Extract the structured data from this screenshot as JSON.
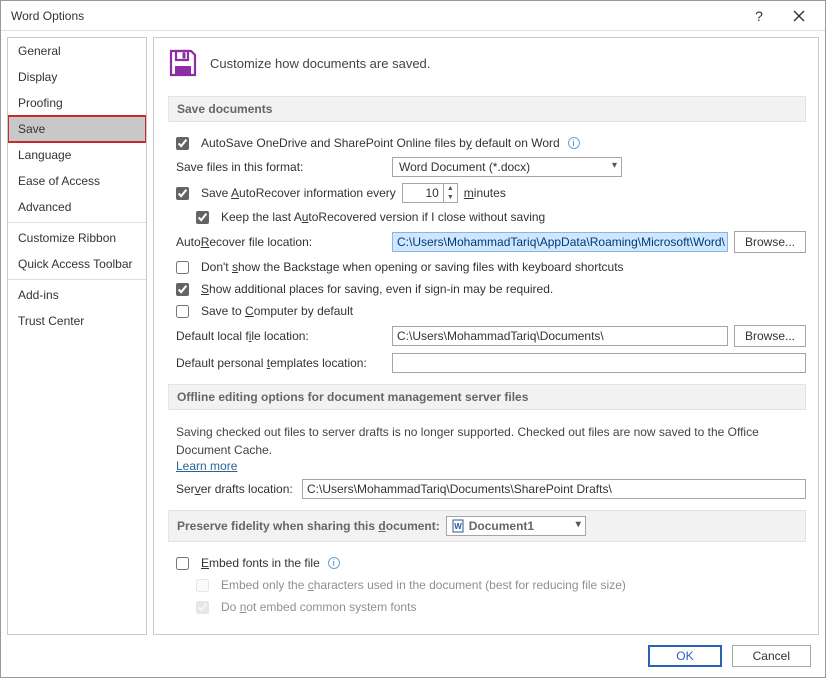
{
  "window": {
    "title": "Word Options"
  },
  "nav": {
    "items": [
      {
        "label": "General"
      },
      {
        "label": "Display"
      },
      {
        "label": "Proofing"
      },
      {
        "label": "Save"
      },
      {
        "label": "Language"
      },
      {
        "label": "Ease of Access"
      },
      {
        "label": "Advanced"
      },
      {
        "label": "Customize Ribbon"
      },
      {
        "label": "Quick Access Toolbar"
      },
      {
        "label": "Add-ins"
      },
      {
        "label": "Trust Center"
      }
    ]
  },
  "header": {
    "text": "Customize how documents are saved."
  },
  "section_save_documents": {
    "title": "Save documents",
    "autosave_label_pre": "AutoSave OneDrive and SharePoint Online files b",
    "autosave_label_post": " default on Word",
    "autosave_u": "y",
    "format_label": "Save files in this format:",
    "format_value": "Word Document (*.docx)",
    "autorecover_pre": "Save ",
    "autorecover_u": "A",
    "autorecover_post": "utoRecover information every",
    "autorecover_value": "10",
    "minutes_u": "m",
    "minutes_post": "inutes",
    "keeplast_pre": "Keep the last A",
    "keeplast_u": "u",
    "keeplast_post": "toRecovered version if I close without saving",
    "arloc_pre": "Auto",
    "arloc_u": "R",
    "arloc_post": "ecover file location:",
    "arloc_value": "C:\\Users\\MohammadTariq\\AppData\\Roaming\\Microsoft\\Word\\",
    "browse1": "Browse...",
    "nobackstage_pre": "Don't ",
    "nobackstage_u": "s",
    "nobackstage_post": "how the Backstage when opening or saving files with keyboard shortcuts",
    "addplaces_pre": "",
    "addplaces_u": "S",
    "addplaces_post": "how additional places for saving, even if sign-in may be required.",
    "savecomp_pre": "Save to ",
    "savecomp_u": "C",
    "savecomp_post": "omputer by default",
    "localfile_pre": "Default local f",
    "localfile_u": "i",
    "localfile_post": "le location:",
    "localfile_value": "C:\\Users\\MohammadTariq\\Documents\\",
    "browse2": "Browse...",
    "templates_pre": "Default personal ",
    "templates_u": "t",
    "templates_post": "emplates location:",
    "templates_value": ""
  },
  "section_offline": {
    "title": "Offline editing options for document management server files",
    "note": "Saving checked out files to server drafts is no longer supported. Checked out files are now saved to the Office Document Cache.",
    "learn_more": "Learn more",
    "drafts_pre": "Ser",
    "drafts_u": "v",
    "drafts_post": "er drafts location:",
    "drafts_value": "C:\\Users\\MohammadTariq\\Documents\\SharePoint Drafts\\"
  },
  "section_preserve": {
    "title_pre": "Preserve fidelity when sharing this ",
    "title_u": "d",
    "title_post": "ocument:",
    "doc_value": "Document1",
    "embed_pre": "",
    "embed_u": "E",
    "embed_post": "mbed fonts in the file",
    "embed_only_pre": "Embed only the ",
    "embed_only_u": "c",
    "embed_only_post": "haracters used in the document (best for reducing file size)",
    "dont_embed_pre": "Do ",
    "dont_embed_u": "n",
    "dont_embed_post": "ot embed common system fonts"
  },
  "footer": {
    "ok": "OK",
    "cancel": "Cancel"
  }
}
